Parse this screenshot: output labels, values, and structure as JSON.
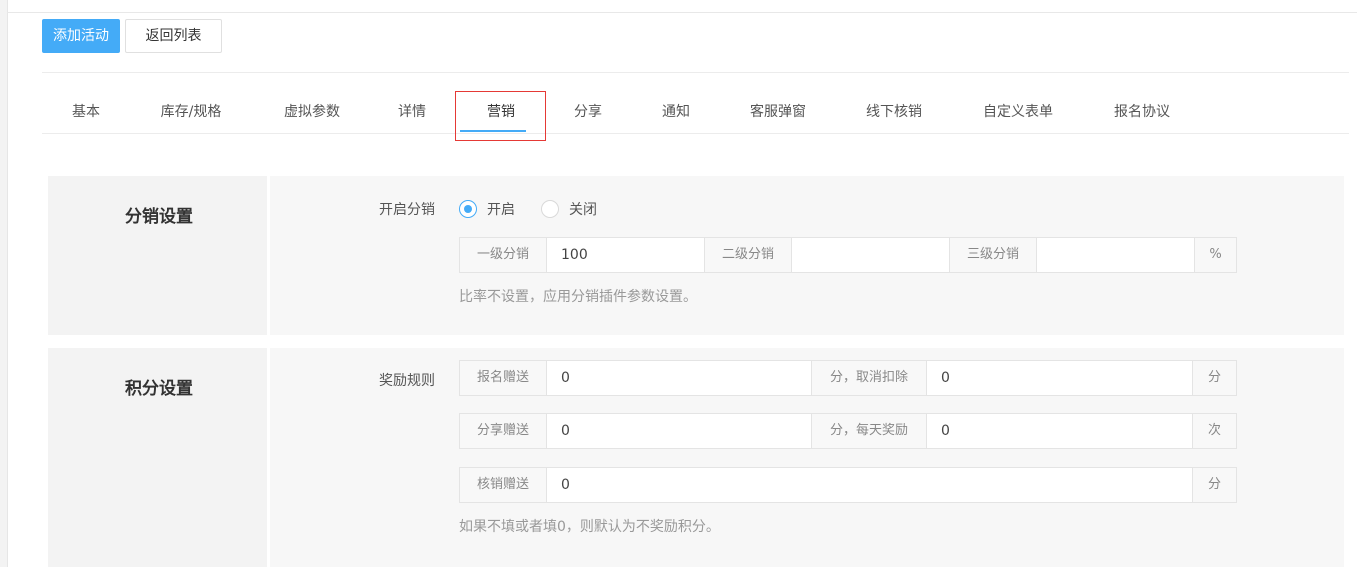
{
  "toolbar": {
    "add_activity": "添加活动",
    "back_to_list": "返回列表"
  },
  "tabs": [
    {
      "label": "基本"
    },
    {
      "label": "库存/规格"
    },
    {
      "label": "虚拟参数"
    },
    {
      "label": "详情"
    },
    {
      "label": "营销",
      "active": true
    },
    {
      "label": "分享"
    },
    {
      "label": "通知"
    },
    {
      "label": "客服弹窗"
    },
    {
      "label": "线下核销"
    },
    {
      "label": "自定义表单"
    },
    {
      "label": "报名协议"
    }
  ],
  "distribution": {
    "title": "分销设置",
    "enable_label": "开启分销",
    "options": [
      {
        "label": "开启",
        "selected": true
      },
      {
        "label": "关闭",
        "selected": false
      }
    ],
    "level1_label": "一级分销",
    "level1_value": "100",
    "level2_label": "二级分销",
    "level2_value": "",
    "level3_label": "三级分销",
    "level3_value": "",
    "unit": "%",
    "help": "比率不设置，应用分销插件参数设置。"
  },
  "points": {
    "title": "积分设置",
    "rule_label": "奖励规则",
    "rows": [
      {
        "label": "报名赠送",
        "value": "0",
        "mid_label": "分，取消扣除",
        "mid_value": "0",
        "unit": "分"
      },
      {
        "label": "分享赠送",
        "value": "0",
        "mid_label": "分，每天奖励",
        "mid_value": "0",
        "unit": "次"
      },
      {
        "label": "核销赠送",
        "value": "0",
        "unit": "分"
      }
    ],
    "help": "如果不填或者填0，则默认为不奖励积分。"
  },
  "colors": {
    "accent": "#44abf7",
    "highlight_box": "#e53935"
  }
}
